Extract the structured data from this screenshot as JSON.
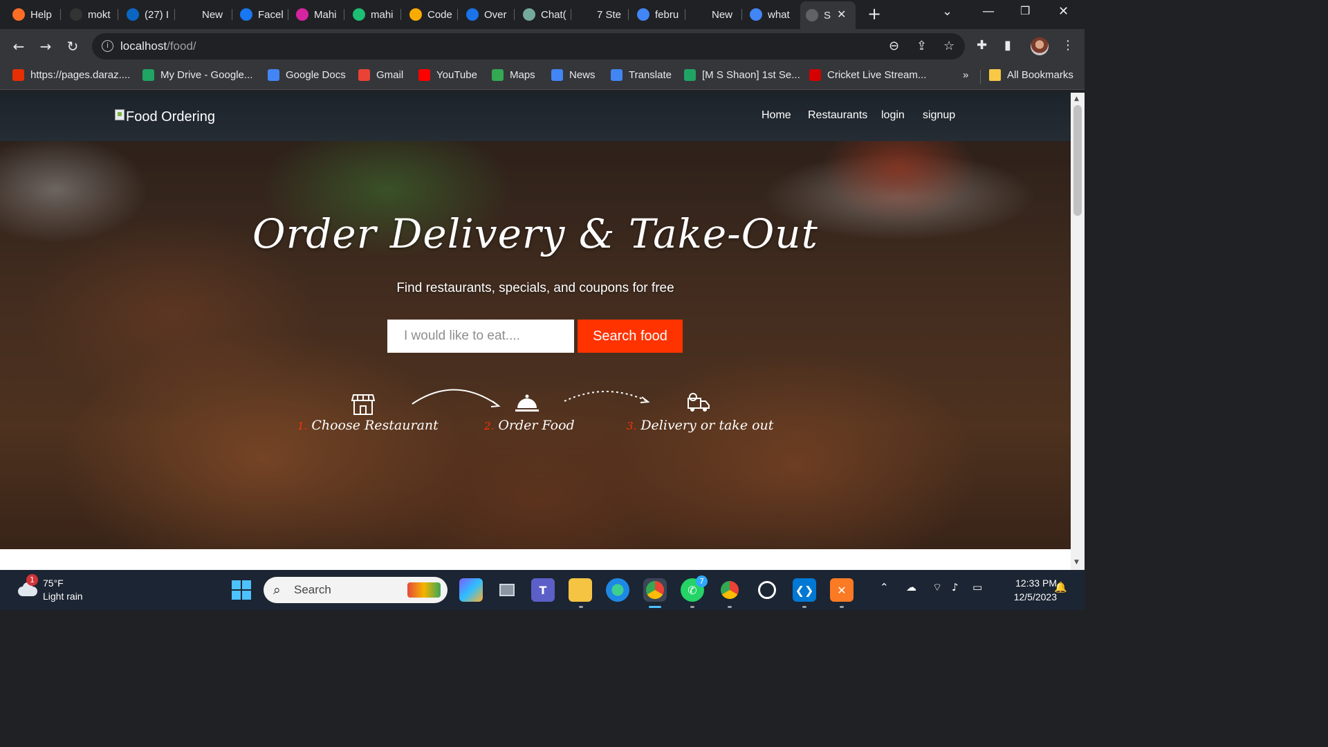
{
  "browser": {
    "tabs": [
      {
        "label": "Help",
        "icon": "gitlab-icon",
        "color": "#fc6d26"
      },
      {
        "label": "mokt",
        "icon": "github-icon",
        "color": "#333333"
      },
      {
        "label": "(27) I",
        "icon": "linkedin-icon",
        "color": "#0a66c2"
      },
      {
        "label": "New",
        "icon": "chatgpt-icon",
        "color": "#202124"
      },
      {
        "label": "Facel",
        "icon": "facebook-icon",
        "color": "#1877f2"
      },
      {
        "label": "Mahi",
        "icon": "instagram-icon",
        "color": "#d6249f"
      },
      {
        "label": "mahi",
        "icon": "fiverr-icon",
        "color": "#1dbf73"
      },
      {
        "label": "Code",
        "icon": "chart-icon",
        "color": "#f9ab00"
      },
      {
        "label": "Over",
        "icon": "overleaf-icon",
        "color": "#1a73e8"
      },
      {
        "label": "Chat(",
        "icon": "openai-icon",
        "color": "#74aa9c"
      },
      {
        "label": "7 Ste",
        "icon": "f-icon",
        "color": "#202124"
      },
      {
        "label": "febru",
        "icon": "google-icon",
        "color": "#4285f4"
      },
      {
        "label": "New",
        "icon": "chatgpt-icon",
        "color": "#202124"
      },
      {
        "label": "what",
        "icon": "google-icon",
        "color": "#4285f4"
      },
      {
        "label": "S",
        "icon": "loading-icon",
        "color": "#5f6368"
      }
    ],
    "url_host": "localhost",
    "url_path": "/food/",
    "bookmarks": [
      {
        "label": "https://pages.daraz....",
        "icon": "daraz-icon",
        "color": "#e62e04"
      },
      {
        "label": "My Drive - Google...",
        "icon": "drive-icon",
        "color": "#1fa463"
      },
      {
        "label": "Google Docs",
        "icon": "docs-icon",
        "color": "#4285f4"
      },
      {
        "label": "Gmail",
        "icon": "gmail-icon",
        "color": "#ea4335"
      },
      {
        "label": "YouTube",
        "icon": "youtube-icon",
        "color": "#ff0000"
      },
      {
        "label": "Maps",
        "icon": "maps-icon",
        "color": "#34a853"
      },
      {
        "label": "News",
        "icon": "news-icon",
        "color": "#4285f4"
      },
      {
        "label": "Translate",
        "icon": "translate-icon",
        "color": "#4285f4"
      },
      {
        "label": "[M S Shaon] 1st Se...",
        "icon": "drive-icon",
        "color": "#1fa463"
      },
      {
        "label": "Cricket Live Stream...",
        "icon": "ts-icon",
        "color": "#d50000"
      }
    ],
    "bookmarks_overflow": "»",
    "all_bookmarks": "All Bookmarks"
  },
  "site": {
    "brand": "Food Ordering",
    "nav": [
      "Home",
      "Restaurants",
      "login",
      "signup"
    ],
    "hero_title": "Order Delivery & Take-Out",
    "hero_subtitle": "Find restaurants, specials, and coupons for free",
    "search_placeholder": "I would like to eat....",
    "search_button": "Search food",
    "steps": [
      {
        "num": "1.",
        "label": "Choose Restaurant",
        "icon": "store-icon"
      },
      {
        "num": "2.",
        "label": "Order Food",
        "icon": "cloche-icon"
      },
      {
        "num": "3.",
        "label": "Delivery or take out",
        "icon": "delivery-truck-icon"
      }
    ],
    "accent": "#ff3300"
  },
  "taskbar": {
    "weather_temp": "75°F",
    "weather_desc": "Light rain",
    "weather_badge": "1",
    "search_label": "Search",
    "time": "12:33 PM",
    "date": "12/5/2023",
    "whatsapp_badge": "7"
  }
}
